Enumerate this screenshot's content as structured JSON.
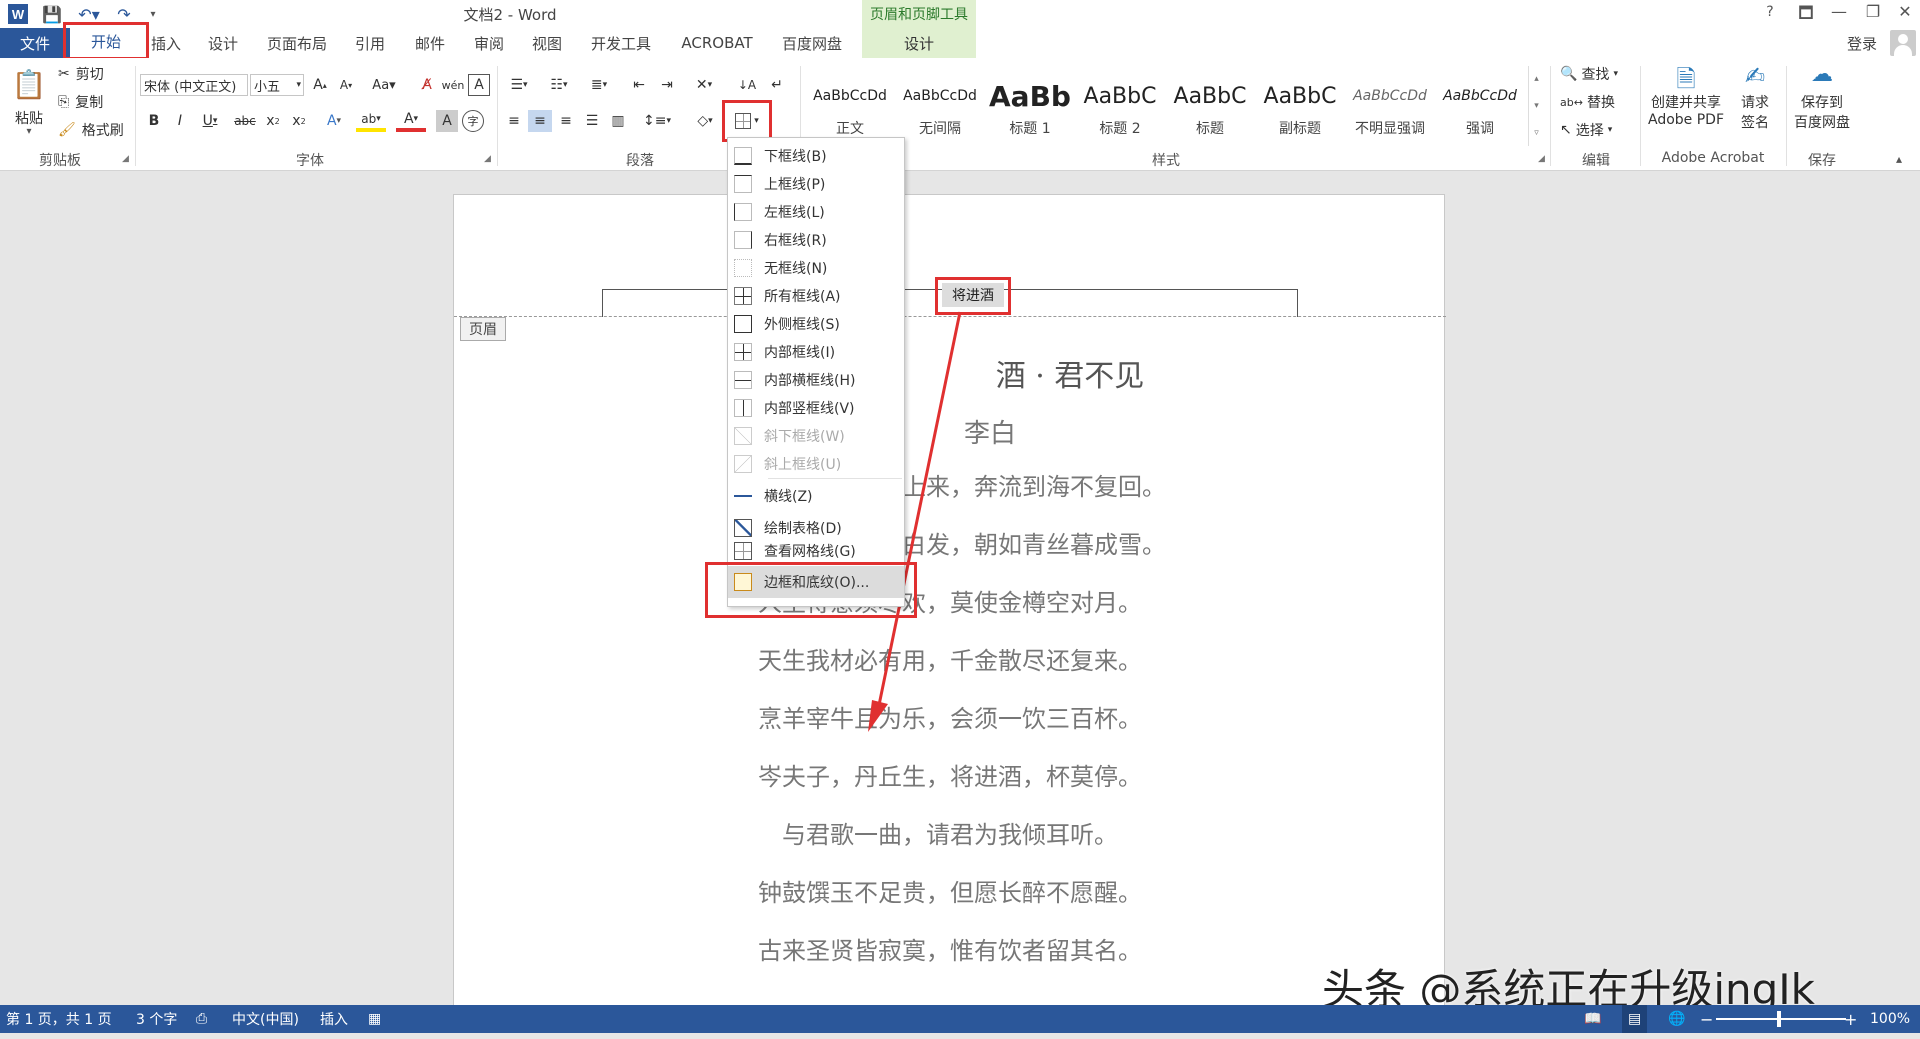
{
  "titlebar": {
    "doc_title": "文档2 - Word",
    "context_group": "页眉和页脚工具",
    "help": "?",
    "restore_ribbon": "🗖",
    "minimize": "—",
    "maximize": "❐",
    "close": "✕"
  },
  "tabs": {
    "file": "文件",
    "home": "开始",
    "insert": "插入",
    "design": "设计",
    "layout": "页面布局",
    "references": "引用",
    "mailings": "邮件",
    "review": "审阅",
    "view": "视图",
    "developer": "开发工具",
    "acrobat": "ACROBAT",
    "baidu": "百度网盘",
    "hf_design": "设计",
    "login": "登录"
  },
  "clipboard": {
    "paste": "粘贴",
    "cut": "剪切",
    "copy": "复制",
    "format_painter": "格式刷",
    "label": "剪贴板"
  },
  "font": {
    "name": "宋体 (中文正文)",
    "size": "小五",
    "label": "字体"
  },
  "paragraph": {
    "label": "段落"
  },
  "styles": {
    "label": "样式",
    "items": [
      {
        "preview": "AaBbCcDd",
        "name": "正文"
      },
      {
        "preview": "AaBbCcDd",
        "name": "无间隔"
      },
      {
        "preview": "AaBb",
        "name": "标题 1"
      },
      {
        "preview": "AaBbC",
        "name": "标题 2"
      },
      {
        "preview": "AaBbC",
        "name": "标题"
      },
      {
        "preview": "AaBbC",
        "name": "副标题"
      },
      {
        "preview": "AaBbCcDd",
        "name": "不明显强调"
      },
      {
        "preview": "AaBbCcDd",
        "name": "强调"
      }
    ]
  },
  "editing": {
    "find": "查找",
    "replace": "替换",
    "select": "选择",
    "label": "编辑"
  },
  "acrobat_group": {
    "create_pdf_1": "创建并共享",
    "create_pdf_2": "Adobe PDF",
    "sign_1": "请求",
    "sign_2": "签名",
    "label": "Adobe Acrobat"
  },
  "save_group": {
    "save_1": "保存到",
    "save_2": "百度网盘",
    "label": "保存"
  },
  "border_menu": {
    "items": [
      {
        "label": "下框线(B)",
        "disabled": false
      },
      {
        "label": "上框线(P)",
        "disabled": false
      },
      {
        "label": "左框线(L)",
        "disabled": false
      },
      {
        "label": "右框线(R)",
        "disabled": false
      },
      {
        "label": "无框线(N)",
        "disabled": false
      },
      {
        "label": "所有框线(A)",
        "disabled": false
      },
      {
        "label": "外侧框线(S)",
        "disabled": false
      },
      {
        "label": "内部框线(I)",
        "disabled": false
      },
      {
        "label": "内部横框线(H)",
        "disabled": false
      },
      {
        "label": "内部竖框线(V)",
        "disabled": false
      },
      {
        "label": "斜下框线(W)",
        "disabled": true
      },
      {
        "label": "斜上框线(U)",
        "disabled": true
      },
      {
        "label": "横线(Z)",
        "disabled": false
      },
      {
        "label": "绘制表格(D)",
        "disabled": false
      },
      {
        "label": "查看网格线(G)",
        "disabled": false
      },
      {
        "label": "边框和底纹(O)...",
        "disabled": false
      }
    ]
  },
  "document": {
    "header_text": "将进酒",
    "header_tag": "页眉",
    "title": "酒 · 君不见",
    "author": "李白",
    "lines": [
      "君不　　　　天上来，奔流到海不复回。",
      "君不　　　　悲白发，朝如青丝暮成雪。",
      "人生得意须尽欢，莫使金樽空对月。",
      "天生我材必有用，千金散尽还复来。",
      "烹羊宰牛且为乐，会须一饮三百杯。",
      "岑夫子，丹丘生，将进酒，杯莫停。",
      "与君歌一曲，请君为我倾耳听。",
      "钟鼓馔玉不足贵，但愿长醉不愿醒。",
      "古来圣贤皆寂寞，惟有饮者留其名。"
    ]
  },
  "statusbar": {
    "page": "第 1 页，共 1 页",
    "words": "3 个字",
    "language": "中文(中国)",
    "mode": "插入",
    "zoom": "100%"
  },
  "watermark": "头条 @系统正在升级ingIk",
  "colors": {
    "accent": "#2b579a",
    "highlight": "#e03030",
    "contextual": "#e0f0d0"
  }
}
